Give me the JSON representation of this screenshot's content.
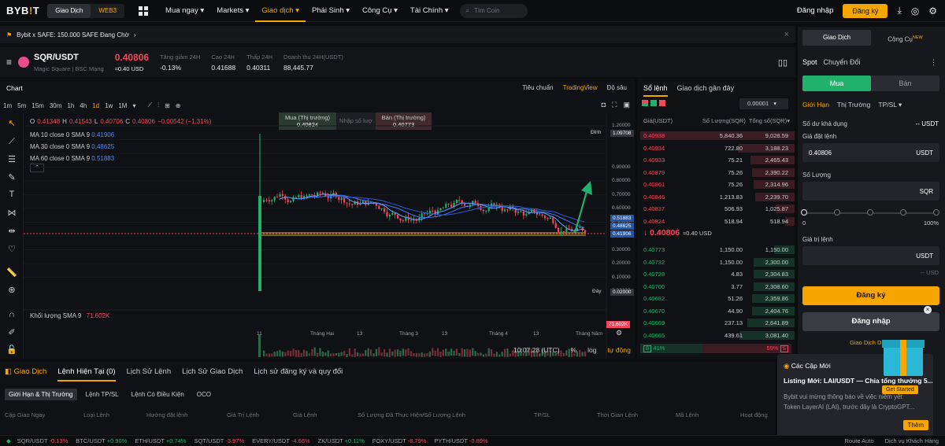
{
  "topnav": {
    "logo": "BYB!T",
    "seg_trade": "Giao Dịch",
    "seg_web3": "WEB3",
    "menu": [
      "Mua ngay ▾",
      "Markets ▾",
      "Giao dịch ▾",
      "Phái Sinh ▾",
      "Công Cụ ▾",
      "Tài Chính ▾"
    ],
    "search_placeholder": "Tìm Coin",
    "login": "Đăng nhập",
    "signup": "Đăng ký"
  },
  "banner": {
    "text": "Bybit x SAFE: 150.000 SAFE Đang Chờ",
    "close": "×"
  },
  "ticker": {
    "symbol": "SQR/USDT",
    "sub1": "Magic Square",
    "sub2": "BSC Mạng",
    "price": "0.40806",
    "usd": "≈0.40 USD",
    "stats": [
      {
        "label": "Tăng giảm 24H",
        "value": "-0.13%"
      },
      {
        "label": "Cao 24H",
        "value": "0.41688"
      },
      {
        "label": "Thấp 24H",
        "value": "0.40311"
      },
      {
        "label": "Doanh thu 24H(USDT)",
        "value": "88,445.77"
      }
    ]
  },
  "chart": {
    "title": "Chart",
    "views": [
      "Tiêu chuẩn",
      "TradingView",
      "Độ sâu"
    ],
    "intervals": [
      "1m",
      "5m",
      "15m",
      "30m",
      "1h",
      "4h",
      "1d",
      "1w",
      "1M"
    ],
    "ohlc": {
      "o": "0.41348",
      "h": "0.41543",
      "l": "0.40706",
      "c": "0.40806",
      "chg": "−0.00542 (−1.31%)"
    },
    "ma": [
      {
        "label": "MA 10 close 0 SMA 9",
        "value": "0.41906",
        "color": "#4e8cff"
      },
      {
        "label": "MA 30 close 0 SMA 9",
        "value": "0.48625",
        "color": "#4e8cff"
      },
      {
        "label": "MA 60 close 0 SMA 9",
        "value": "0.51883",
        "color": "#4e8cff"
      }
    ],
    "buy_label": "Mua (Thị trường)",
    "buy_price": "0.40824",
    "mid_label": "Nhập số lượ",
    "sell_label": "Bán (Thị trường)",
    "sell_price": "0.40773",
    "yticks": [
      "1.20000",
      "1.10000",
      "0.90000",
      "0.80000",
      "0.70000",
      "0.60000",
      "0.50000",
      "0.40000",
      "0.30000",
      "0.20000",
      "0.10000",
      "0.00000"
    ],
    "ymarks": [
      {
        "label": "Đỉnh",
        "value": "1.09708"
      },
      {
        "label": "Đáy",
        "value": "0.02000"
      }
    ],
    "marker_values": [
      "0.51883",
      "0.48625",
      "0.41906"
    ],
    "xticks": [
      "11",
      "Tháng Hai",
      "13",
      "Tháng 3",
      "13",
      "Tháng 4",
      "13",
      "Tháng Năm"
    ],
    "volume_label": "Khối lượng SMA 9",
    "volume_value": "71.602K",
    "volume_tag": "71.602K",
    "clock": "10:07:28 (UTC)",
    "pct": "%",
    "log": "log",
    "auto": "tự động"
  },
  "orderbook": {
    "tabs": [
      "Sổ lệnh",
      "Giao dịch gần đây"
    ],
    "precision": "0.00001",
    "cols": [
      "Giá(USDT)",
      "Số Lượng(SQR)",
      "Tổng số(SQR)"
    ],
    "asks": [
      [
        "0.40938",
        "5,840.36",
        "9,028.59"
      ],
      [
        "0.40934",
        "722.80",
        "3,188.23"
      ],
      [
        "0.40933",
        "75.21",
        "2,465.43"
      ],
      [
        "0.40879",
        "75.26",
        "2,390.22"
      ],
      [
        "0.40861",
        "75.26",
        "2,314.96"
      ],
      [
        "0.40846",
        "1,213.83",
        "2,239.70"
      ],
      [
        "0.40837",
        "506.93",
        "1,025.87"
      ],
      [
        "0.40824",
        "518.94",
        "518.94"
      ]
    ],
    "ask_depth": [
      0.98,
      0.36,
      0.28,
      0.27,
      0.26,
      0.25,
      0.12,
      0.06
    ],
    "last": "↓ 0.40806",
    "last_usd": "≈0.40 USD",
    "bids": [
      [
        "0.40773",
        "1,150.00",
        "1,150.00"
      ],
      [
        "0.40732",
        "1,150.00",
        "2,300.00"
      ],
      [
        "0.40728",
        "4.83",
        "2,304.83"
      ],
      [
        "0.40700",
        "3.77",
        "2,308.60"
      ],
      [
        "0.40682",
        "51.26",
        "2,359.86"
      ],
      [
        "0.40670",
        "44.90",
        "2,404.76"
      ],
      [
        "0.40669",
        "237.13",
        "2,641.89"
      ],
      [
        "0.40665",
        "439.61",
        "3,081.40"
      ]
    ],
    "bid_depth": [
      0.13,
      0.26,
      0.26,
      0.26,
      0.27,
      0.27,
      0.3,
      0.35
    ],
    "buy_pct": "41%",
    "sell_pct": "59%",
    "buy_ratio": 0.41
  },
  "trade": {
    "tabs": [
      "Giao Dịch",
      "Công Cụ"
    ],
    "new_badge": "NEW",
    "spot": "Spot",
    "convert": "Chuyển Đổi",
    "buy": "Mua",
    "sell": "Bán",
    "types": [
      "Giới Hạn",
      "Thị Trường",
      "TP/SL ▾"
    ],
    "avail_label": "Số dư khả dụng",
    "avail_value": "-- USDT",
    "price_label": "Giá đặt lệnh",
    "price_value": "0.40806",
    "price_unit": "USDT",
    "qty_label": "Số Lượng",
    "qty_unit": "SQR",
    "slider_min": "0",
    "slider_max": "100%",
    "value_label": "Giá trị lệnh",
    "value_unit": "USDT",
    "value_est": "-- USD",
    "signup": "Đăng ký",
    "login": "Đăng nhập",
    "demo": "Giao Dịch D"
  },
  "bottom": {
    "tabs": [
      "Giao Dịch",
      "Lệnh Hiện Tại (0)",
      "Lịch Sử Lệnh",
      "Lịch Sử Giao Dịch",
      "Lịch sử đăng ký và quy đổi"
    ],
    "subtabs": [
      "Giới Hạn & Thị Trường",
      "Lệnh TP/SL",
      "Lệnh Có Điều Kiện",
      "OCO"
    ],
    "cols": [
      "Cặp Giao Ngay",
      "Loại Lệnh",
      "Hướng đặt lệnh",
      "Giá Trị Lệnh",
      "Giá Lệnh",
      "Số Lượng Đã Thực Hiện/Số Lượng Lệnh",
      "TP/SL",
      "Thời Gian Lệnh",
      "Mã Lệnh",
      "Hoạt động"
    ]
  },
  "popup": {
    "title": "Các Cập Mới",
    "headline": "Listing Mới: LAI/USDT — Chia tổng thưởng 5...",
    "body1": "Bybit vui mừng thông báo về việc niêm yết",
    "body2": "Token LayerAI (LAI), trước đây là CryptoGPT...",
    "more": "Thêm",
    "gift": "Get Started"
  },
  "statusbar": [
    {
      "pair": "SQR/USDT",
      "chg": "-0.13%",
      "up": false
    },
    {
      "pair": "BTC/USDT",
      "chg": "+0.90%",
      "up": true
    },
    {
      "pair": "ETH/USDT",
      "chg": "+0.74%",
      "up": true
    },
    {
      "pair": "SQT/USDT",
      "chg": "-3.97%",
      "up": false
    },
    {
      "pair": "EVERY/USDT",
      "chg": "-4.66%",
      "up": false
    },
    {
      "pair": "ZK/USDT",
      "chg": "+0.11%",
      "up": true
    },
    {
      "pair": "FOXY/USDT",
      "chg": "-8.79%",
      "up": false
    },
    {
      "pair": "PYTH/USDT",
      "chg": "-0.89%",
      "up": false
    }
  ],
  "status_right": {
    "route": "Route Auto",
    "support": "Dịch vụ Khách Hàng"
  },
  "colors": {
    "accent": "#f7a600",
    "up": "#20b26c",
    "down": "#f6465d"
  }
}
